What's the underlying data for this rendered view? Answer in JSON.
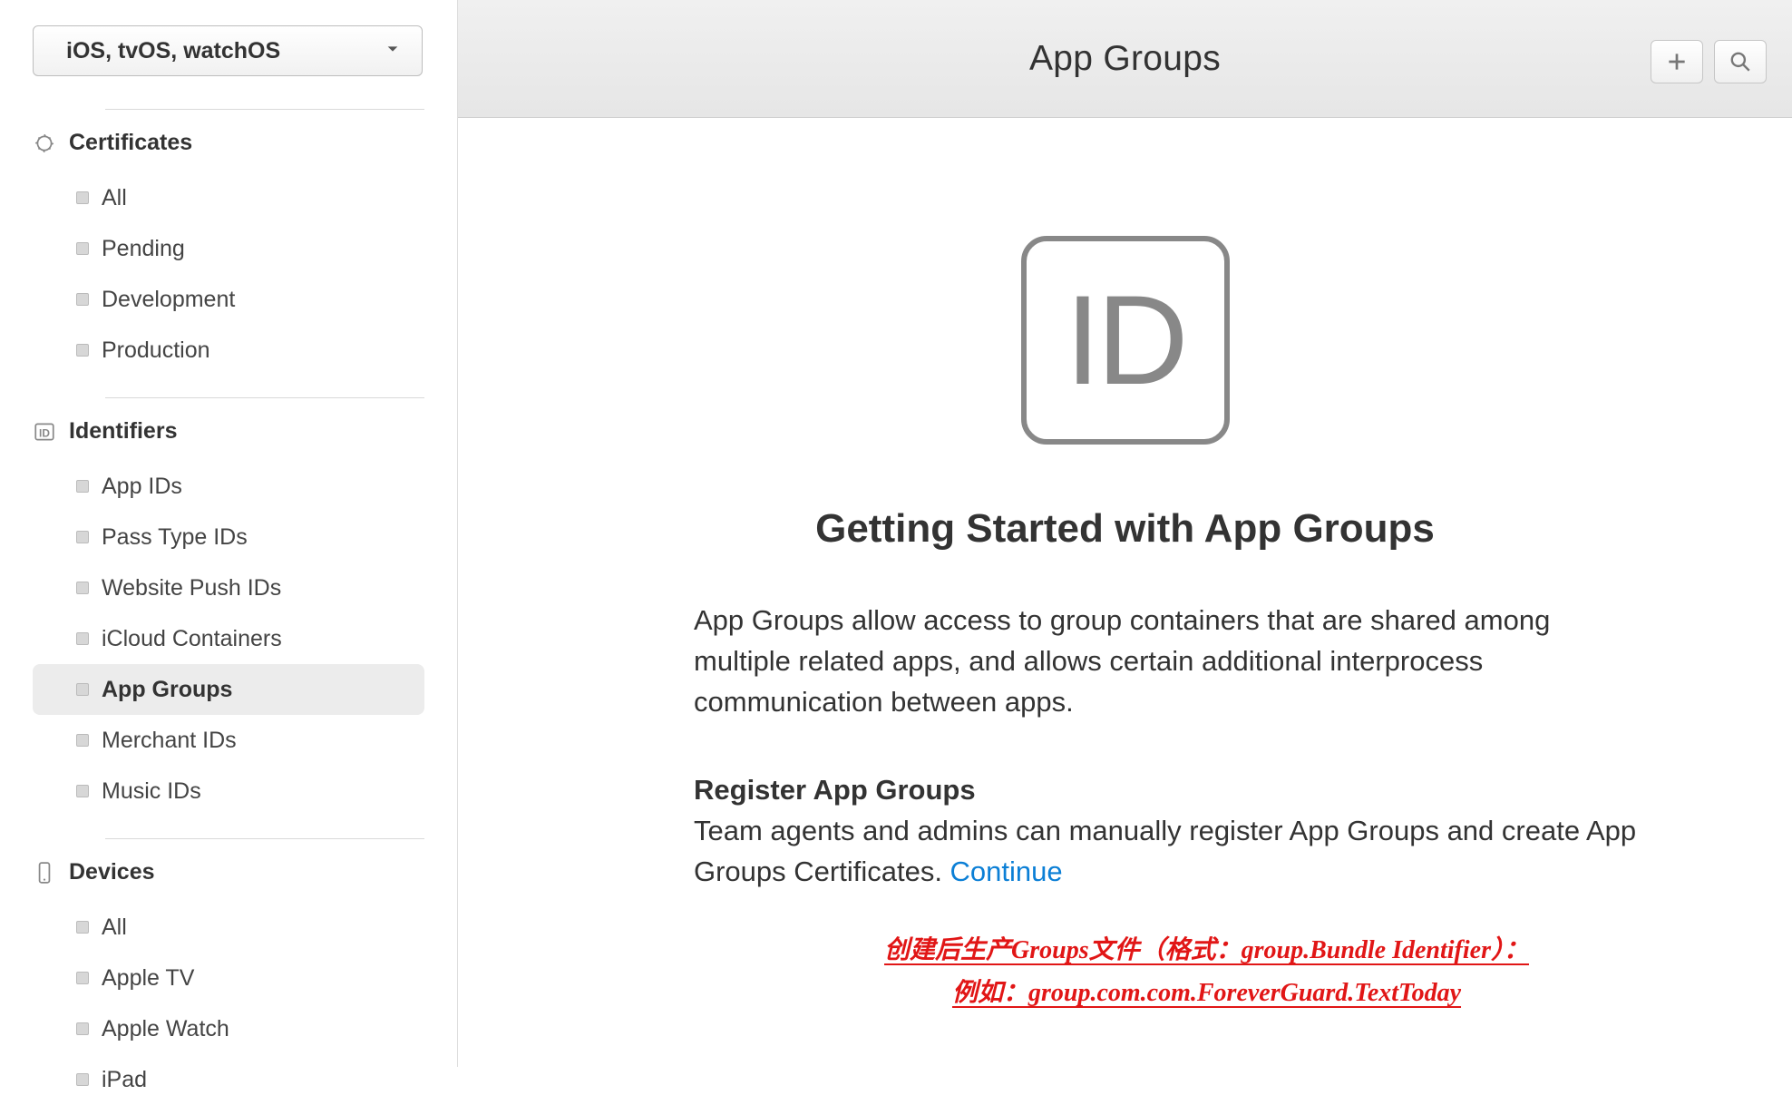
{
  "sidebar": {
    "platform_selector": "iOS, tvOS, watchOS",
    "sections": [
      {
        "title": "Certificates",
        "items": [
          {
            "label": "All",
            "active": false
          },
          {
            "label": "Pending",
            "active": false
          },
          {
            "label": "Development",
            "active": false
          },
          {
            "label": "Production",
            "active": false
          }
        ]
      },
      {
        "title": "Identifiers",
        "items": [
          {
            "label": "App IDs",
            "active": false
          },
          {
            "label": "Pass Type IDs",
            "active": false
          },
          {
            "label": "Website Push IDs",
            "active": false
          },
          {
            "label": "iCloud Containers",
            "active": false
          },
          {
            "label": "App Groups",
            "active": true
          },
          {
            "label": "Merchant IDs",
            "active": false
          },
          {
            "label": "Music IDs",
            "active": false
          }
        ]
      },
      {
        "title": "Devices",
        "items": [
          {
            "label": "All",
            "active": false
          },
          {
            "label": "Apple TV",
            "active": false
          },
          {
            "label": "Apple Watch",
            "active": false
          },
          {
            "label": "iPad",
            "active": false
          }
        ]
      }
    ]
  },
  "main": {
    "title": "App Groups",
    "badge_text": "ID",
    "hero_title": "Getting Started with App Groups",
    "hero_desc": "App Groups allow access to group containers that are shared among multiple related apps, and allows certain additional interprocess communication between apps.",
    "register_heading": "Register App Groups",
    "register_body": "Team agents and admins can manually register App Groups and create App Groups Certificates. ",
    "continue": "Continue",
    "annotation_line1": "创建后生产Groups文件（格式：group.Bundle Identifier）：",
    "annotation_line2": "例如：group.com.com.ForeverGuard.TextToday"
  }
}
